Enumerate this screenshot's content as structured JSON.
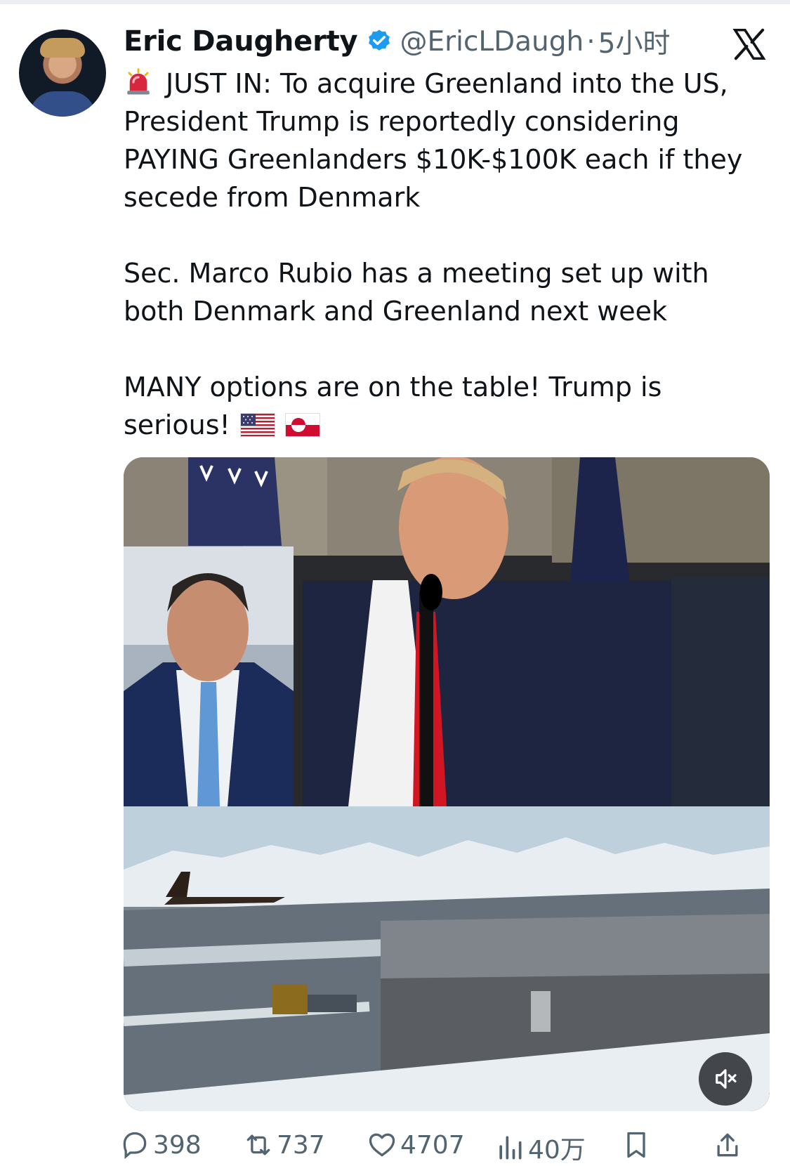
{
  "tweet": {
    "author_name": "Eric Daugherty",
    "handle": "@EricLDaugh",
    "separator": "·",
    "time": "5小时",
    "line1": "JUST IN: To acquire Greenland into the US, President Trump is reportedly considering PAYING Greenlanders $10K-$100K each if they secede from Denmark",
    "line2": "Sec. Marco Rubio has a meeting set up with both Denmark and Greenland next week",
    "line3": "MANY options are on the table! Trump is serious!",
    "flags": [
      "us-flag-icon",
      "greenland-flag-icon"
    ],
    "media": {
      "sound": "muted"
    }
  },
  "metrics": {
    "replies": "398",
    "reposts": "737",
    "likes": "4707",
    "views": "40万"
  },
  "colors": {
    "text": "#0f1419",
    "secondary": "#536471",
    "verified": "#1d9bf0",
    "background": "#ffffff"
  },
  "icons": {
    "verified": "verified-badge-icon",
    "platform": "x-logo-icon",
    "siren": "siren-icon",
    "reply": "reply-icon",
    "repost": "repost-icon",
    "like": "heart-icon",
    "views": "views-chart-icon",
    "bookmark": "bookmark-icon",
    "share": "share-icon",
    "mute": "mute-icon"
  }
}
